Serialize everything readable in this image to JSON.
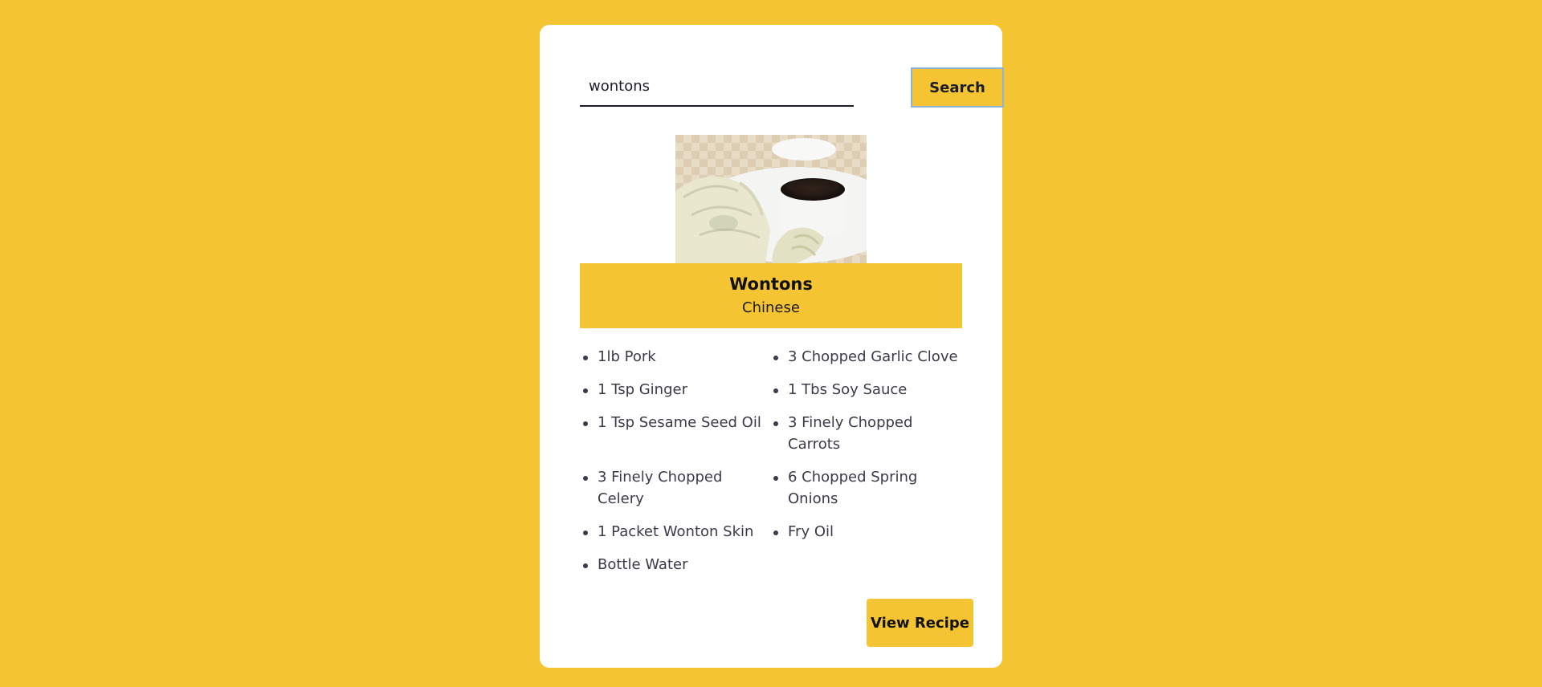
{
  "search": {
    "value": "wontons",
    "button_label": "Search"
  },
  "recipe": {
    "title": "Wontons",
    "cuisine": "Chinese",
    "ingredients": [
      "1lb Pork",
      "3 Chopped Garlic Clove",
      "1 Tsp Ginger",
      "1 Tbs Soy Sauce",
      "1 Tsp Sesame Seed Oil",
      "3 Finely Chopped Carrots",
      "3 Finely Chopped Celery",
      "6 Chopped Spring Onions",
      "1 Packet Wonton Skin",
      "Fry Oil",
      "Bottle Water"
    ],
    "view_button_label": "View Recipe"
  },
  "colors": {
    "background": "#f5c432",
    "card": "#ffffff",
    "accent": "#f5c432",
    "text": "#1d1d2b"
  }
}
